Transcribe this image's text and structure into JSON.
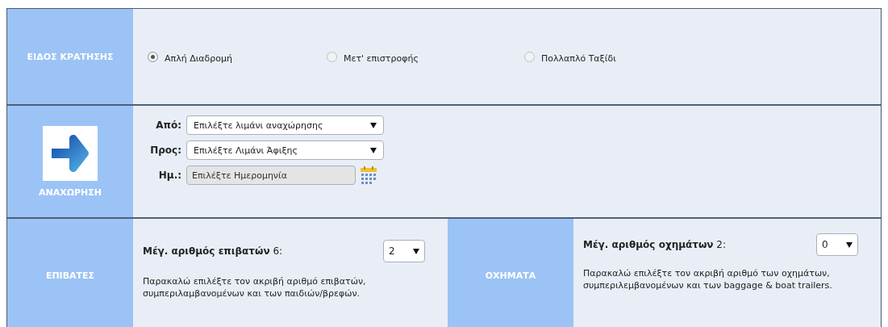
{
  "booking_type": {
    "label": "ΕΙΔΟΣ ΚΡΑΤΗΣΗΣ",
    "options": [
      {
        "label": "Απλή Διαδρομή",
        "selected": true
      },
      {
        "label": "Μετ' επιστροφής",
        "selected": false
      },
      {
        "label": "Πολλαπλό Ταξίδι",
        "selected": false
      }
    ]
  },
  "departure": {
    "label": "ΑΝΑΧΩΡΗΣΗ",
    "fields": [
      {
        "kind": "select",
        "label": "Από:",
        "value": "Επιλέξτε λιμάνι αναχώρησης"
      },
      {
        "kind": "select",
        "label": "Προς:",
        "value": "Επιλέξτε Λιμάνι Άφιξης"
      },
      {
        "kind": "date",
        "label": "Ημ.:",
        "placeholder": "Επιλέξτε Ημερομηνία"
      }
    ]
  },
  "passengers": {
    "label": "ΕΠΙΒΑΤΕΣ",
    "max_label": "Μέγ. αριθμός επιβατών",
    "max_value": "6:",
    "value": "2",
    "note": "Παρακαλώ επιλέξτε τον ακριβή αριθμό επιβατών, συμπεριλαμβανομένων και των παιδιών/βρεφών."
  },
  "vehicles": {
    "label": "ΟΧΗΜΑΤΑ",
    "max_label": "Μέγ. αριθμός οχημάτων",
    "max_value": "2:",
    "value": "0",
    "note": "Παρακαλώ επιλέξτε τον ακριβή αριθμό των οχημάτων, συμπεριλεμβανομένων και των baggage & boat trailers."
  }
}
